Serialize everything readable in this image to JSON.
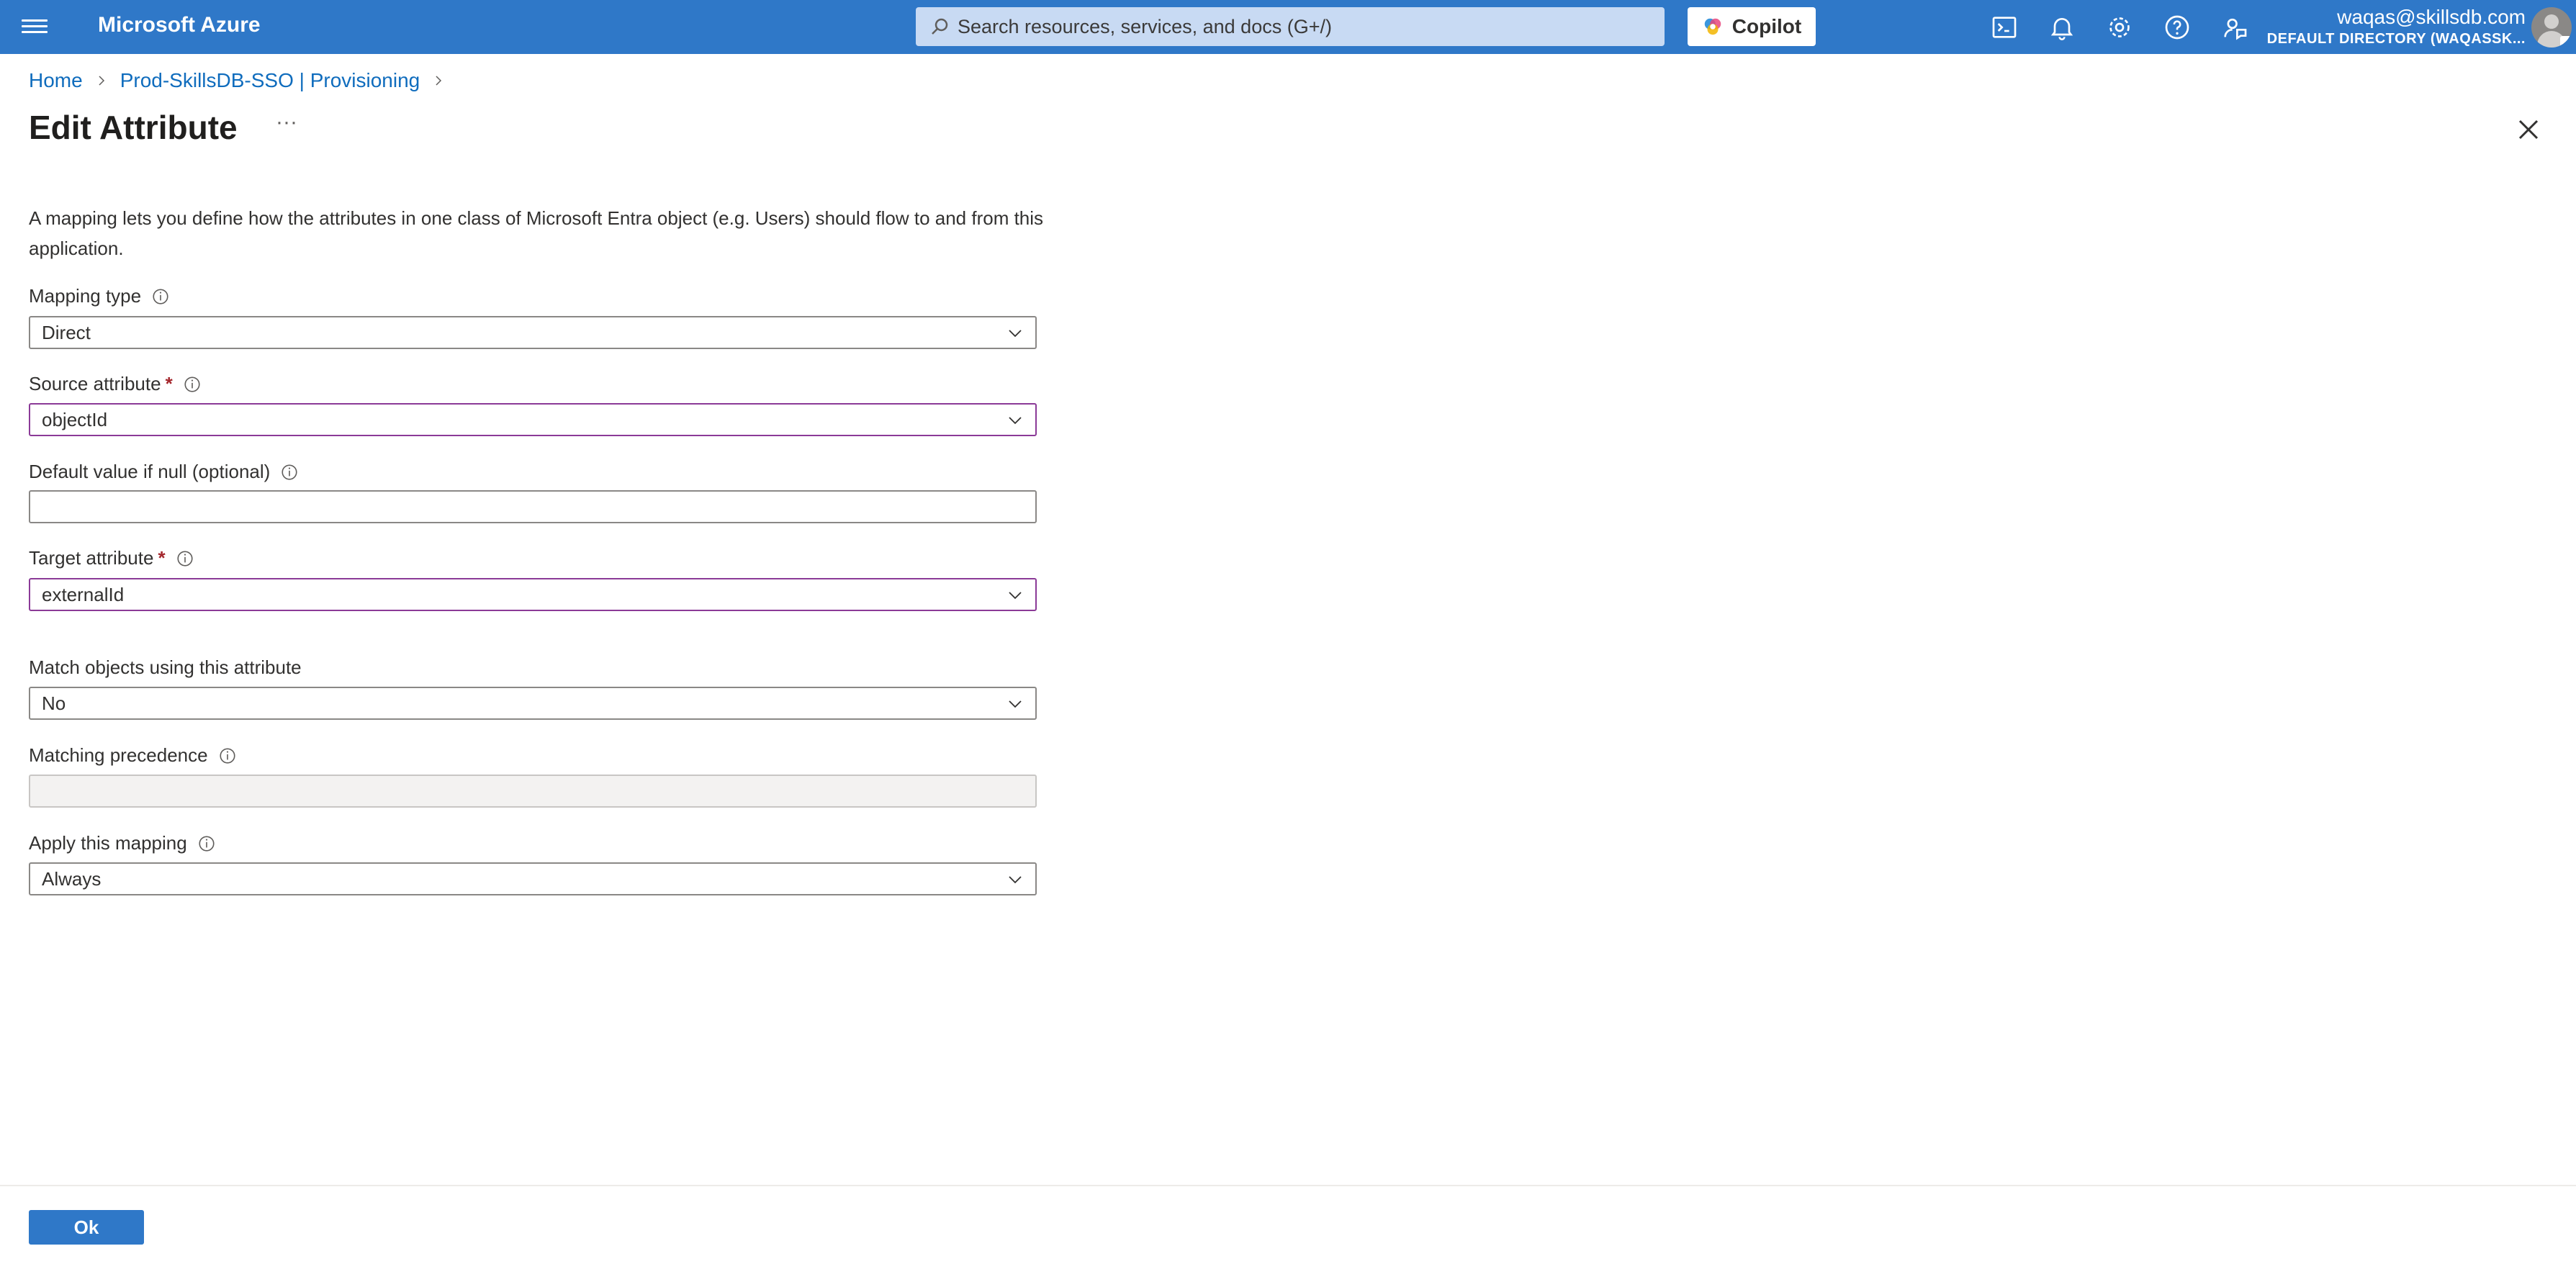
{
  "topbar": {
    "brand": "Microsoft Azure",
    "search_placeholder": "Search resources, services, and docs (G+/)",
    "copilot_label": "Copilot",
    "user_email": "waqas@skillsdb.com",
    "user_directory": "DEFAULT DIRECTORY (WAQASSK..."
  },
  "breadcrumb": {
    "home": "Home",
    "app": "Prod-SkillsDB-SSO | Provisioning"
  },
  "page": {
    "title": "Edit Attribute",
    "more": "···",
    "description": "A mapping lets you define how the attributes in one class of Microsoft Entra object (e.g. Users) should flow to and from this application."
  },
  "form": {
    "mapping_type": {
      "label": "Mapping type",
      "value": "Direct"
    },
    "source_attribute": {
      "label": "Source attribute",
      "required": "*",
      "value": "objectId"
    },
    "default_value": {
      "label": "Default value if null (optional)",
      "value": ""
    },
    "target_attribute": {
      "label": "Target attribute",
      "required": "*",
      "value": "externalId"
    },
    "match_objects": {
      "label": "Match objects using this attribute",
      "value": "No"
    },
    "matching_precedence": {
      "label": "Matching precedence",
      "value": ""
    },
    "apply_mapping": {
      "label": "Apply this mapping",
      "value": "Always"
    }
  },
  "footer": {
    "ok_label": "Ok"
  },
  "colors": {
    "topbar": "#2f78c8",
    "link": "#0f6cbd",
    "focus_border": "#8b3a97",
    "required": "#a4262c"
  }
}
